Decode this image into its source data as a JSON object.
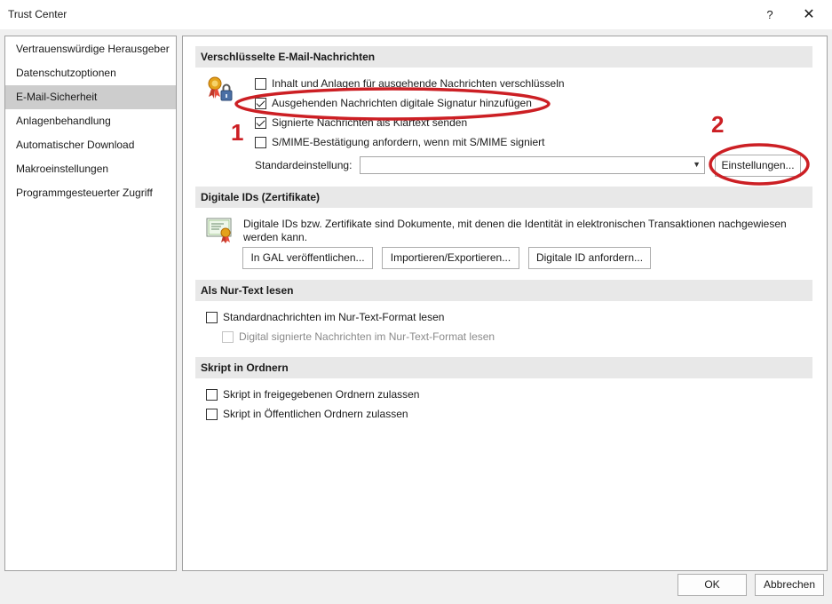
{
  "window": {
    "title": "Trust Center",
    "help_glyph": "?",
    "close_glyph": "✕"
  },
  "sidebar": {
    "items": [
      {
        "label": "Vertrauenswürdige Herausgeber"
      },
      {
        "label": "Datenschutzoptionen"
      },
      {
        "label": "E-Mail-Sicherheit",
        "selected": true
      },
      {
        "label": "Anlagenbehandlung"
      },
      {
        "label": "Automatischer Download"
      },
      {
        "label": "Makroeinstellungen"
      },
      {
        "label": "Programmgesteuerter Zugriff"
      }
    ]
  },
  "encrypted": {
    "header": "Verschlüsselte E-Mail-Nachrichten",
    "opt_encrypt": {
      "label": "Inhalt und Anlagen für ausgehende Nachrichten verschlüsseln",
      "checked": false
    },
    "opt_sign": {
      "label": "Ausgehenden Nachrichten digitale Signatur hinzufügen",
      "checked": true
    },
    "opt_cleartext": {
      "label": "Signierte Nachrichten als Klartext senden",
      "checked": true
    },
    "opt_smime": {
      "label": "S/MIME-Bestätigung anfordern, wenn mit S/MIME signiert",
      "checked": false
    },
    "default_label": "Standardeinstellung:",
    "default_value": "",
    "settings_button": "Einstellungen..."
  },
  "digital_ids": {
    "header": "Digitale IDs (Zertifikate)",
    "description": "Digitale IDs bzw. Zertifikate sind Dokumente, mit denen die Identität in elektronischen Transaktionen nachgewiesen werden kann.",
    "btn_publish": "In GAL veröffentlichen...",
    "btn_import": "Importieren/Exportieren...",
    "btn_request": "Digitale ID anfordern..."
  },
  "plaintext": {
    "header": "Als Nur-Text lesen",
    "opt_standard": {
      "label": "Standardnachrichten im Nur-Text-Format lesen",
      "checked": false
    },
    "opt_signed": {
      "label": "Digital signierte Nachrichten im Nur-Text-Format lesen",
      "checked": false,
      "disabled": true
    }
  },
  "script": {
    "header": "Skript in Ordnern",
    "opt_shared": {
      "label": "Skript in freigegebenen Ordnern zulassen",
      "checked": false
    },
    "opt_public": {
      "label": "Skript in Öffentlichen Ordnern zulassen",
      "checked": false
    }
  },
  "footer": {
    "ok": "OK",
    "cancel": "Abbrechen"
  },
  "annotations": {
    "step1": "1",
    "step2": "2",
    "color": "#cc1f24"
  }
}
